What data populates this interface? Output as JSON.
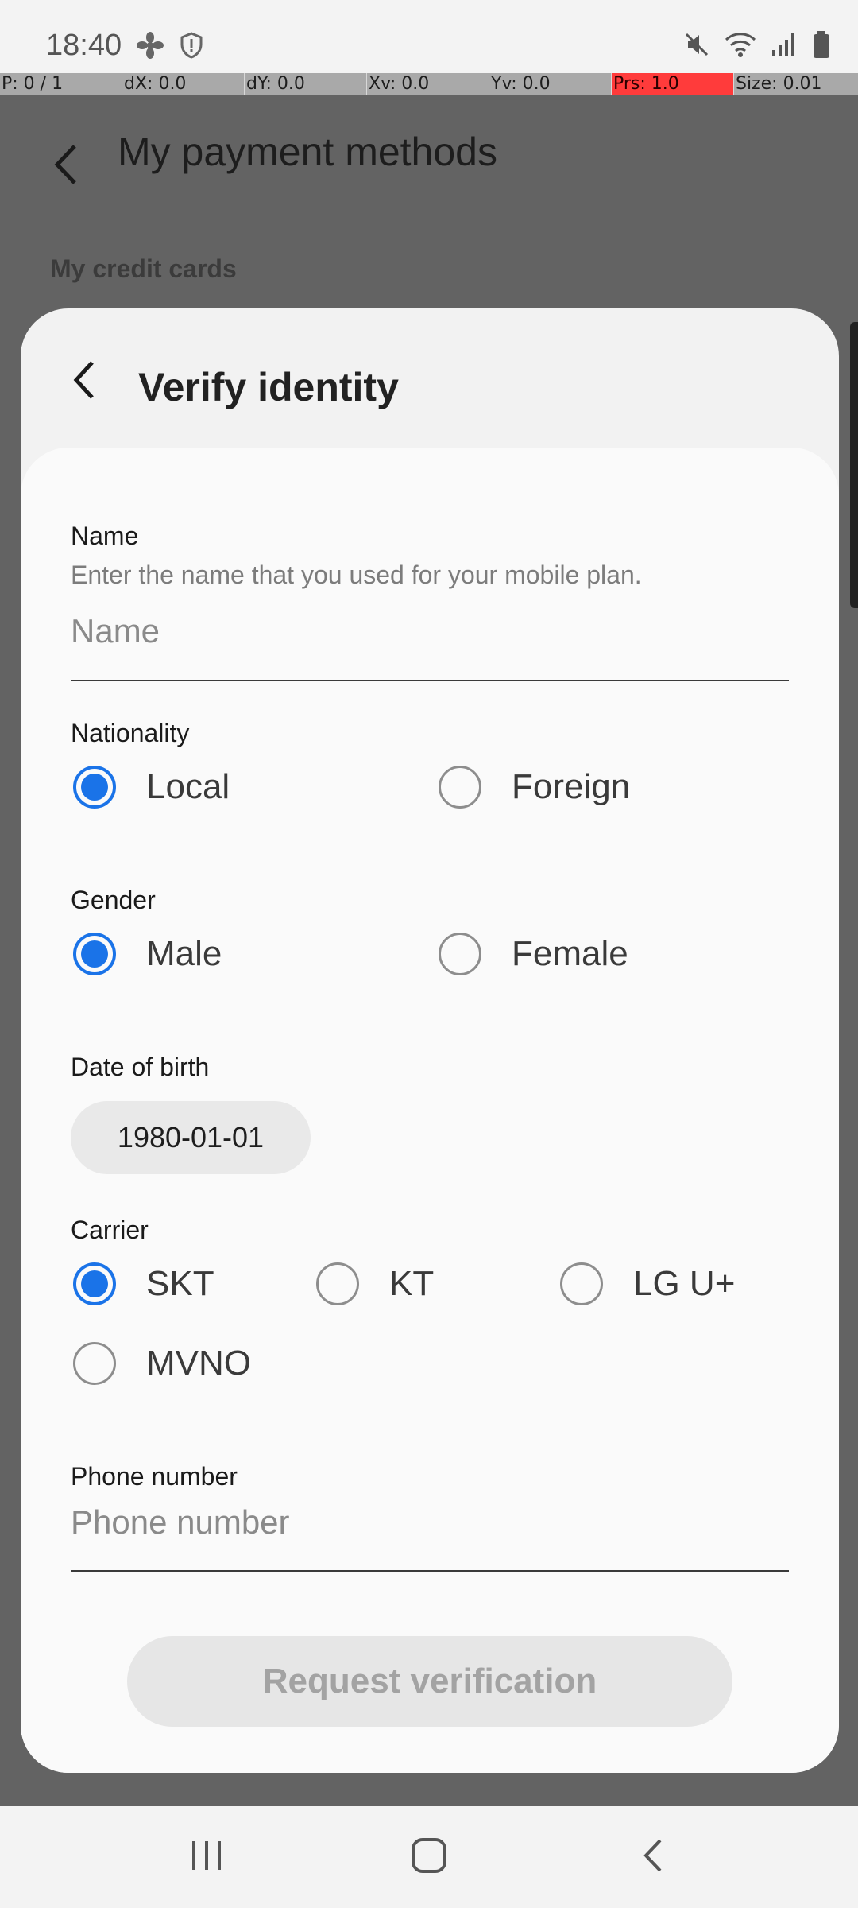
{
  "status_bar": {
    "time": "18:40",
    "left_icons": [
      "fan-icon",
      "shield-icon"
    ],
    "right_icons": [
      "mute-icon",
      "wifi-icon",
      "signal-icon",
      "battery-icon"
    ]
  },
  "debug_bar": {
    "p": "P: 0 / 1",
    "dx": "dX: 0.0",
    "dy": "dY: 0.0",
    "xv": "Xv: 0.0",
    "yv": "Yv: 0.0",
    "prs": "Prs: 1.0",
    "size": "Size: 0.01"
  },
  "background": {
    "title": "My payment methods",
    "section": "My credit cards"
  },
  "sheet": {
    "title": "Verify identity",
    "name": {
      "label": "Name",
      "helper": "Enter the name that you used for your mobile plan.",
      "placeholder": "Name"
    },
    "nationality": {
      "label": "Nationality",
      "options": [
        "Local",
        "Foreign"
      ],
      "selected": "Local"
    },
    "gender": {
      "label": "Gender",
      "options": [
        "Male",
        "Female"
      ],
      "selected": "Male"
    },
    "dob": {
      "label": "Date of birth",
      "value": "1980-01-01"
    },
    "carrier": {
      "label": "Carrier",
      "options": [
        "SKT",
        "KT",
        "LG U+",
        "MVNO"
      ],
      "selected": "SKT"
    },
    "phone": {
      "label": "Phone number",
      "placeholder": "Phone number"
    },
    "request_button": "Request verification"
  },
  "colors": {
    "accent": "#1a73e8",
    "scrim": "#636363",
    "sheet_bg": "#f2f2f2",
    "card_bg": "#fafafa",
    "debug_highlight": "#ff3b3b"
  },
  "nav": {
    "icons": [
      "recents-icon",
      "home-icon",
      "back-icon"
    ]
  }
}
